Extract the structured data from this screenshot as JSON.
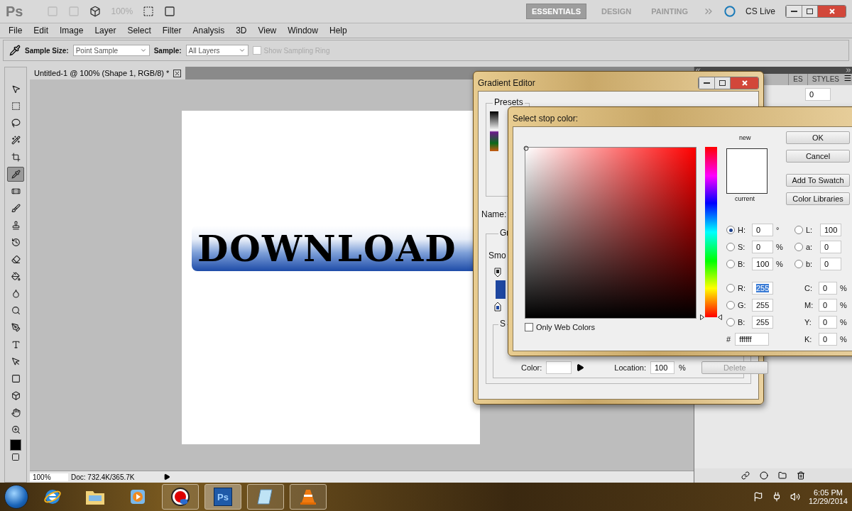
{
  "app_bar": {
    "logo": "Ps",
    "zoom": "100%",
    "workspaces": [
      {
        "label": "ESSENTIALS",
        "selected": true
      },
      {
        "label": "DESIGN",
        "selected": false
      },
      {
        "label": "PAINTING",
        "selected": false
      }
    ],
    "cs_live": "CS Live"
  },
  "menu": [
    "File",
    "Edit",
    "Image",
    "Layer",
    "Select",
    "Filter",
    "Analysis",
    "3D",
    "View",
    "Window",
    "Help"
  ],
  "options_bar": {
    "sample_size_label": "Sample Size:",
    "sample_size": "Point Sample",
    "sample_label": "Sample:",
    "sample": "All Layers",
    "sampling_ring": {
      "label": "Show Sampling Ring",
      "checked": false,
      "disabled": true
    }
  },
  "tools": [
    {
      "selected": false
    },
    {
      "selected": false
    },
    {
      "selected": false
    },
    {
      "selected": false
    },
    {
      "selected": false
    },
    {
      "selected": true
    },
    {
      "selected": false
    },
    {
      "selected": false
    },
    {
      "selected": false
    },
    {
      "selected": false
    },
    {
      "selected": false
    },
    {
      "selected": false
    },
    {
      "selected": false
    },
    {
      "selected": false
    },
    {
      "selected": false
    },
    {
      "selected": false
    },
    {
      "selected": false
    },
    {
      "selected": false
    },
    {
      "selected": false
    },
    {
      "selected": false
    },
    {
      "selected": false
    }
  ],
  "document": {
    "tab": "Untitled-1 @ 100% (Shape 1, RGB/8) *",
    "canvas_text": "DOWNLOAD",
    "zoom": "100%",
    "doc_info": "Doc: 732.4K/365.7K"
  },
  "panel": {
    "tabs": [
      "ES",
      "STYLES"
    ],
    "value": "0"
  },
  "gradient_editor": {
    "title": "Gradient Editor",
    "presets": "Presets",
    "name_label": "Name:",
    "type_label": "Gr",
    "smoothness_label": "Smo",
    "stops_label": "S",
    "color_label": "Color:",
    "location_label": "Location:",
    "location": "100",
    "percent": "%",
    "delete": "Delete"
  },
  "color_picker": {
    "title": "Select stop color:",
    "new": "new",
    "current": "current",
    "buttons": [
      "OK",
      "Cancel",
      "Add To Swatch",
      "Color Libraries"
    ],
    "only_web": {
      "label": "Only Web Colors",
      "checked": false
    },
    "hsb": [
      {
        "label": "H:",
        "value": "0",
        "unit": "°",
        "selected": true
      },
      {
        "label": "S:",
        "value": "0",
        "unit": "%",
        "selected": false
      },
      {
        "label": "B:",
        "value": "100",
        "unit": "%",
        "selected": false
      }
    ],
    "rgb": [
      {
        "label": "R:",
        "value": "255",
        "highlighted": true,
        "selected": false
      },
      {
        "label": "G:",
        "value": "255",
        "highlighted": false,
        "selected": false
      },
      {
        "label": "B:",
        "value": "255",
        "highlighted": false,
        "selected": false
      }
    ],
    "lab": [
      {
        "label": "L:",
        "value": "100",
        "selected": false
      },
      {
        "label": "a:",
        "value": "0",
        "selected": false
      },
      {
        "label": "b:",
        "value": "0",
        "selected": false
      }
    ],
    "cmyk": [
      {
        "label": "C:",
        "value": "0",
        "unit": "%"
      },
      {
        "label": "M:",
        "value": "0",
        "unit": "%"
      },
      {
        "label": "Y:",
        "value": "0",
        "unit": "%"
      },
      {
        "label": "K:",
        "value": "0",
        "unit": "%"
      }
    ],
    "hex_label": "#",
    "hex": "ffffff",
    "hue": {
      "level": 0
    }
  },
  "taskbar": {
    "apps": [
      {
        "kind": "browser",
        "running": false,
        "selected": false
      },
      {
        "kind": "folder",
        "running": false,
        "selected": false
      },
      {
        "kind": "media",
        "running": false,
        "selected": false
      },
      {
        "kind": "recorder",
        "running": true,
        "selected": false
      },
      {
        "kind": "photoshop",
        "label": "Ps",
        "running": true,
        "selected": true
      },
      {
        "kind": "notepad",
        "running": true,
        "selected": false
      },
      {
        "kind": "cone",
        "running": true,
        "selected": false
      }
    ],
    "time": "6:05 PM",
    "date": "12/29/2014"
  }
}
